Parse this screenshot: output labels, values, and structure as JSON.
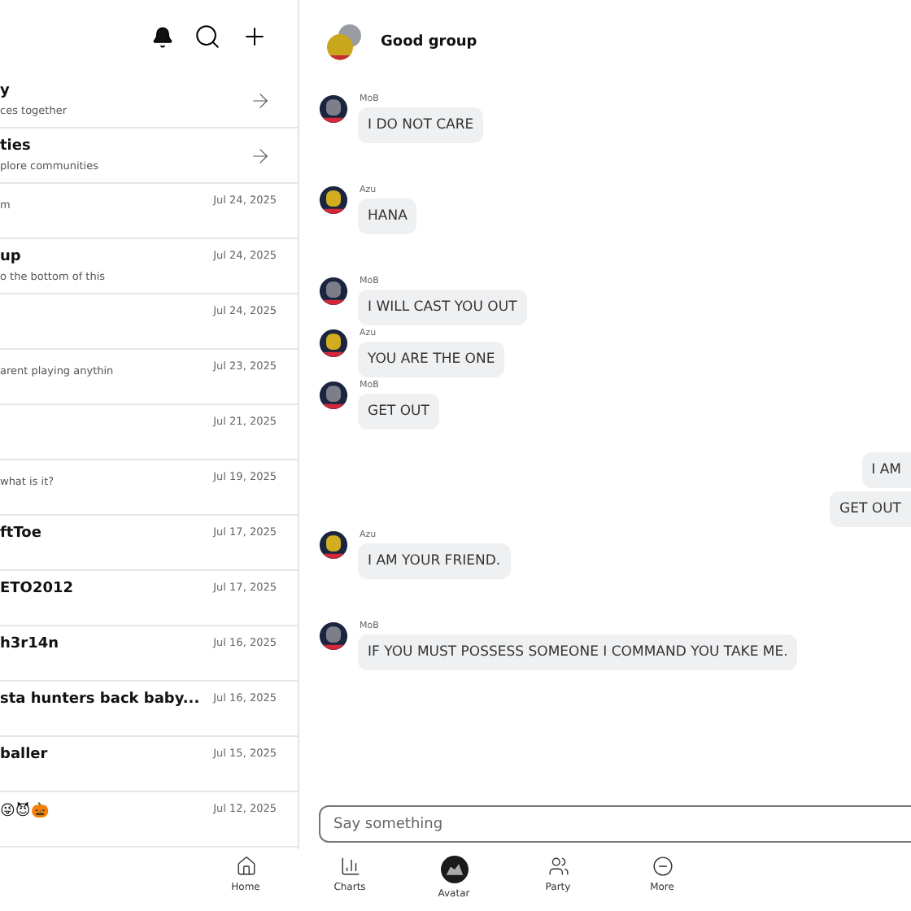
{
  "sidebar": {
    "shortcuts": [
      {
        "title": "y",
        "subtitle": "ces together"
      },
      {
        "title": "ties",
        "subtitle": "plore communities"
      }
    ],
    "chats": [
      {
        "subtitle": "m",
        "date": "Jul 24, 2025"
      },
      {
        "title": "up",
        "subtitle": "o the bottom of this",
        "date": "Jul 24, 2025"
      },
      {
        "date": "Jul 24, 2025"
      },
      {
        "subtitle": "arent playing anythin",
        "date": "Jul 23, 2025"
      },
      {
        "date": "Jul 21, 2025"
      },
      {
        "subtitle": "what is it?",
        "date": "Jul 19, 2025"
      },
      {
        "title": "ftToe",
        "date": "Jul 17, 2025"
      },
      {
        "title": "ETO2012",
        "date": "Jul 17, 2025"
      },
      {
        "title": "h3r14n",
        "date": "Jul 16, 2025"
      },
      {
        "title": "sta hunters back baby...",
        "date": "Jul 16, 2025"
      },
      {
        "title": "baller",
        "date": "Jul 15, 2025"
      },
      {
        "title": "😜😈🎃",
        "date": "Jul 12, 2025"
      }
    ]
  },
  "chat": {
    "title": "Good group",
    "messages": [
      {
        "kind": "incoming",
        "sender": "MoB",
        "color": "#7c7f8a",
        "text": "I DO NOT CARE"
      },
      {
        "kind": "incoming",
        "sender": "Azu",
        "color": "#d1ad1f",
        "text": "HANA"
      },
      {
        "kind": "incoming",
        "sender": "MoB",
        "color": "#7c7f8a",
        "text": "I WILL CAST YOU OUT"
      },
      {
        "kind": "incoming",
        "sender": "Azu",
        "color": "#d1ad1f",
        "text": "YOU ARE THE ONE"
      },
      {
        "kind": "incoming",
        "sender": "MoB",
        "color": "#7c7f8a",
        "text": "GET OUT"
      },
      {
        "kind": "outgoing",
        "text": "I AM"
      },
      {
        "kind": "outgoing",
        "text": "GET OUT"
      },
      {
        "kind": "incoming",
        "sender": "Azu",
        "color": "#d1ad1f",
        "text": "I AM YOUR FRIEND."
      },
      {
        "kind": "incoming",
        "sender": "MoB",
        "color": "#7c7f8a",
        "text": "IF YOU MUST POSSESS SOMEONE I COMMAND YOU TAKE ME."
      }
    ],
    "input": {
      "placeholder": "Say something"
    }
  },
  "nav": [
    {
      "kind": "home",
      "label": "Home"
    },
    {
      "kind": "charts",
      "label": "Charts"
    },
    {
      "kind": "avatar",
      "label": "Avatar"
    },
    {
      "kind": "party",
      "label": "Party"
    },
    {
      "kind": "more",
      "label": "More"
    }
  ]
}
